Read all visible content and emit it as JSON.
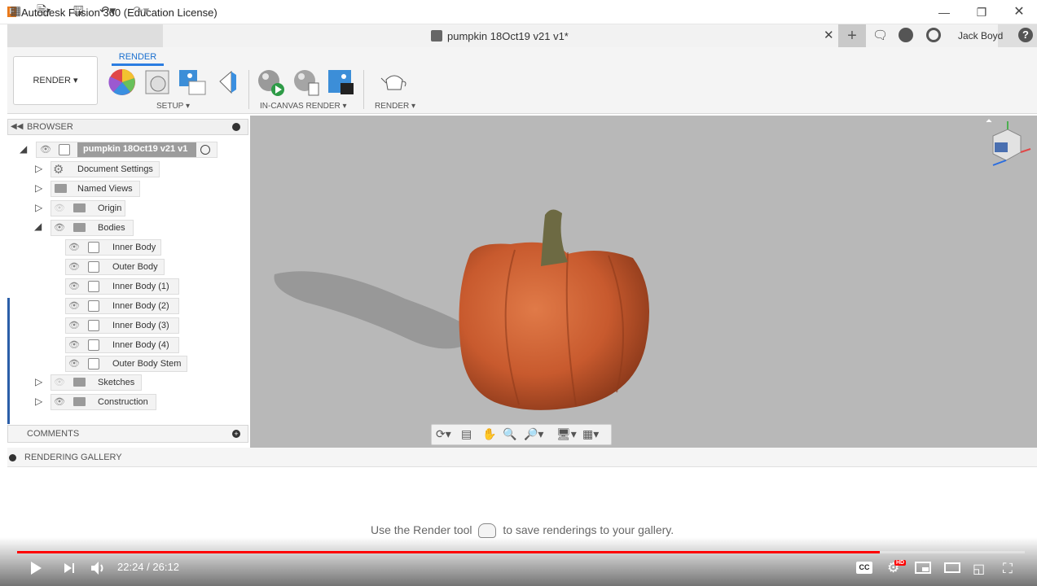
{
  "window": {
    "title": "Autodesk Fusion 360 (Education License)",
    "app_icon_letter": "F"
  },
  "document_tab": {
    "title": "pumpkin 18Oct19 v21 v1*"
  },
  "user": {
    "name": "Jack Boyd"
  },
  "ribbon": {
    "workspace_label": "RENDER ▾",
    "active_tab": "RENDER",
    "groups": [
      {
        "label": "SETUP ▾"
      },
      {
        "label": "IN-CANVAS RENDER ▾"
      },
      {
        "label": "RENDER ▾"
      }
    ]
  },
  "browser": {
    "title": "BROWSER",
    "root": "pumpkin 18Oct19 v21 v1",
    "items": [
      {
        "label": "Document Settings"
      },
      {
        "label": "Named Views"
      },
      {
        "label": "Origin"
      },
      {
        "label": "Bodies"
      },
      {
        "label": "Inner Body"
      },
      {
        "label": "Outer Body"
      },
      {
        "label": "Inner Body (1)"
      },
      {
        "label": "Inner Body (2)"
      },
      {
        "label": "Inner Body (3)"
      },
      {
        "label": "Inner Body (4)"
      },
      {
        "label": "Outer Body Stem"
      },
      {
        "label": "Sketches"
      },
      {
        "label": "Construction"
      }
    ]
  },
  "comments": {
    "title": "COMMENTS"
  },
  "gallery": {
    "title": "RENDERING GALLERY",
    "hint_before": "Use the Render tool",
    "hint_after": "to save renderings to your gallery."
  },
  "player": {
    "current_time": "22:24",
    "separator": " / ",
    "duration": "26:12",
    "progress_fraction": 0.856,
    "cc_label": "CC",
    "hd_label": "HD"
  },
  "colors": {
    "accent": "#2b7de1",
    "progress": "#ff0000",
    "pumpkin": "#c85a2e"
  }
}
